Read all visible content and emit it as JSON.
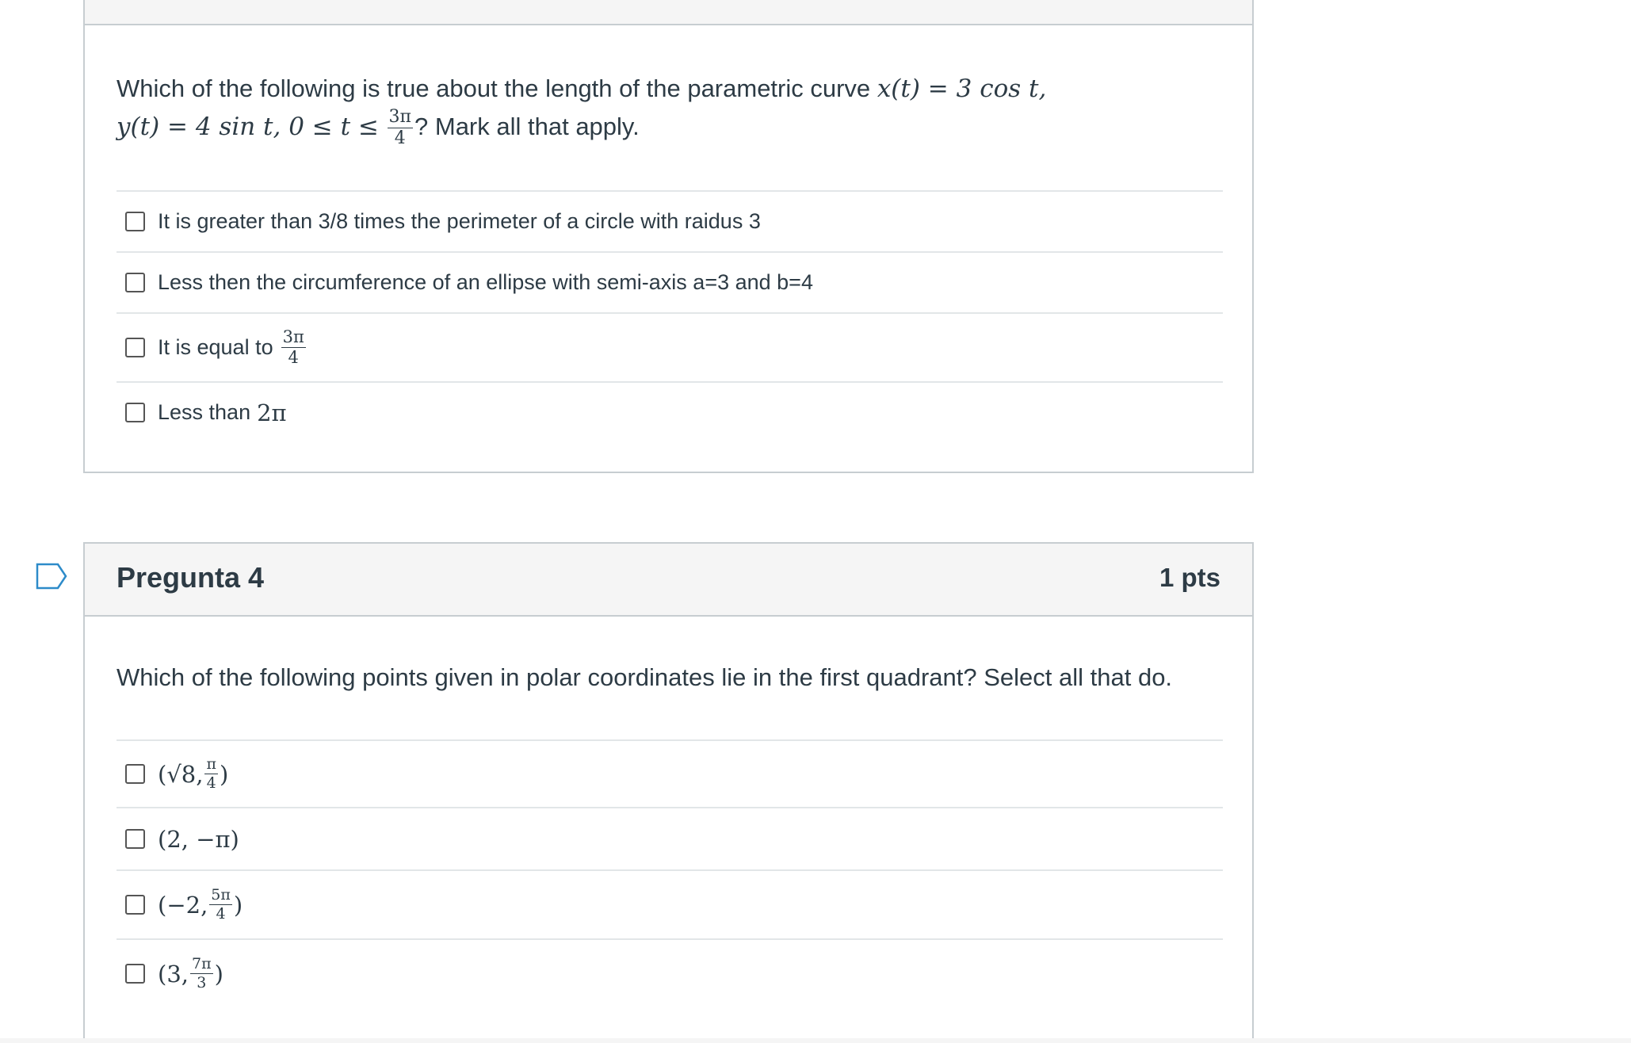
{
  "question3": {
    "text_part1": "Which of the following is true about the length of the parametric curve",
    "text_part2": "? Mark all that apply.",
    "math_x": "x(t) = 3 cos t,",
    "math_y": "y(t) = 4 sin t, 0 ≤ t ≤",
    "frac_num": "3π",
    "frac_den": "4",
    "answers": [
      "It is greater than 3/8 times the perimeter of a circle with raidus 3",
      "Less then the circumference of an ellipse with semi-axis a=3 and b=4",
      "It is equal to",
      "Less than"
    ],
    "ans3_num": "3π",
    "ans3_den": "4",
    "ans4_math": "2π"
  },
  "question4": {
    "title": "Pregunta 4",
    "points": "1 pts",
    "text": "Which of the following points given in polar coordinates lie in the first quadrant? Select all that do.",
    "answers": [
      {
        "pre": "(√8, ",
        "num": "π",
        "den": "4",
        "post": ")"
      },
      {
        "pre": "(2, −π)",
        "num": "",
        "den": "",
        "post": ""
      },
      {
        "pre": "(−2, ",
        "num": "5π",
        "den": "4",
        "post": ")"
      },
      {
        "pre": "(3, ",
        "num": "7π",
        "den": "3",
        "post": ")"
      }
    ]
  },
  "icons": {
    "flag": "flag-outline-icon"
  }
}
